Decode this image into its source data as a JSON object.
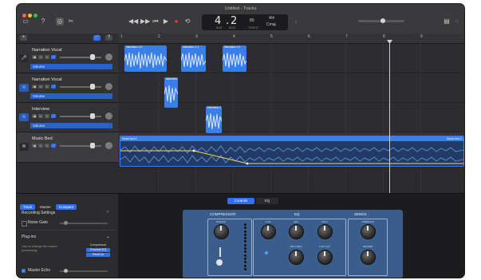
{
  "window": {
    "title": "Untitled - Tracks"
  },
  "toolbar": {
    "lcd": {
      "bar": "4",
      "beat": "2",
      "bar_label": "BAR",
      "beat_label": "BEAT",
      "tempo": "80",
      "tempo_label": "TEMPO",
      "signature": "4/4",
      "key": "Cmaj"
    }
  },
  "tracks": [
    {
      "name": "Narration Vocal",
      "automation": "Volume"
    },
    {
      "name": "Narration Vocal",
      "automation": "Volume"
    },
    {
      "name": "Interview",
      "automation": "Volume"
    },
    {
      "name": "Music Bed",
      "automation": ""
    }
  ],
  "ruler": {
    "ticks": [
      "1",
      "2",
      "3",
      "4",
      "5",
      "6",
      "7",
      "8",
      "9"
    ]
  },
  "regions": {
    "r1a": "Narration 1.0",
    "r1b": "Narration 1.1",
    "r1c": "Narration 1.2",
    "r2": "Narration",
    "r3": "Interview 1",
    "music_left": "Music bed.1",
    "music_right": "Music bed.1"
  },
  "bottom": {
    "tabs": [
      "Track",
      "Master",
      "Compare"
    ],
    "recording_settings": "Recording Settings",
    "noise_gate": "Noise Gate",
    "plugins": "Plug-ins",
    "plugins_hint": "Use to change the sound processing.",
    "plugin_list": [
      "Compressor",
      "Channel EQ",
      "PitchCor"
    ],
    "master_echo": "Master Echo",
    "segments": [
      "Controls",
      "EQ"
    ],
    "sections": [
      "COMPRESSOR",
      "EQ",
      "SENDS"
    ],
    "knob_labels": [
      "AMOUNT",
      "LOW",
      "MID",
      "HIGH",
      "AMBIENCE",
      "MID FREQ",
      "LOW CUT",
      "REVERB"
    ]
  },
  "colors": {
    "accent": "#2f6ff2",
    "region": "#3a7fe8",
    "plugin_panel": "#3b5d8c"
  }
}
